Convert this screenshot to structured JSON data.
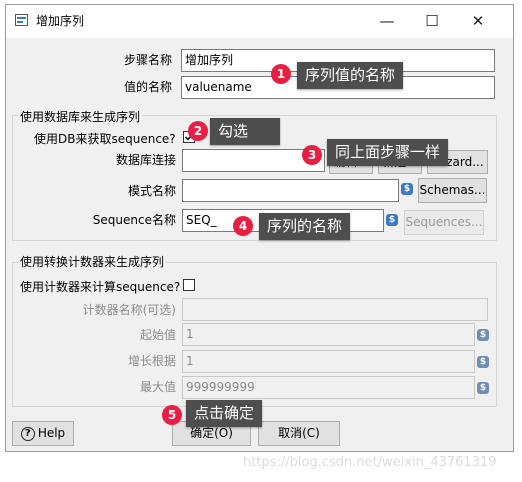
{
  "window": {
    "title": "增加序列",
    "minimize_glyph": "—",
    "maximize_glyph": "☐",
    "close_glyph": "✕"
  },
  "fields": {
    "step_name_label": "步骤名称",
    "step_name_value": "增加序列",
    "value_name_label": "值的名称",
    "value_name_value": "valuename"
  },
  "db_group": {
    "title": "使用数据库来生成序列",
    "use_db_label": "使用DB来获取sequence?",
    "use_db_checked": true,
    "connection_label": "数据库连接",
    "connection_value": "",
    "edit_button": "编辑...",
    "new_button": "新建...",
    "wizard_button": "Wizard...",
    "schema_label": "模式名称",
    "schema_value": "",
    "schemas_button": "Schemas...",
    "sequence_label": "Sequence名称",
    "sequence_value": "SEQ_",
    "sequences_button": "Sequences..."
  },
  "counter_group": {
    "title": "使用转换计数器来生成序列",
    "use_counter_label": "使用计数器来计算sequence?",
    "use_counter_checked": false,
    "counter_name_label": "计数器名称(可选)",
    "counter_name_value": "",
    "start_label": "起始值",
    "start_value": "1",
    "increment_label": "增长根据",
    "increment_value": "1",
    "max_label": "最大值",
    "max_value": "999999999"
  },
  "buttons": {
    "help": "Help",
    "ok": "确定(O)",
    "cancel": "取消(C)"
  },
  "annotations": [
    {
      "num": "1",
      "text": "序列值的名称"
    },
    {
      "num": "2",
      "text": "勾选"
    },
    {
      "num": "3",
      "text": "同上面步骤一样"
    },
    {
      "num": "4",
      "text": "序列的名称"
    },
    {
      "num": "5",
      "text": "点击确定"
    }
  ],
  "watermark": "https://blog.csdn.net/weixin_43761319",
  "colors": {
    "badge": "#e81e43",
    "tooltip": "#4e4e4e",
    "variable_icon": "#3d7ac4"
  }
}
